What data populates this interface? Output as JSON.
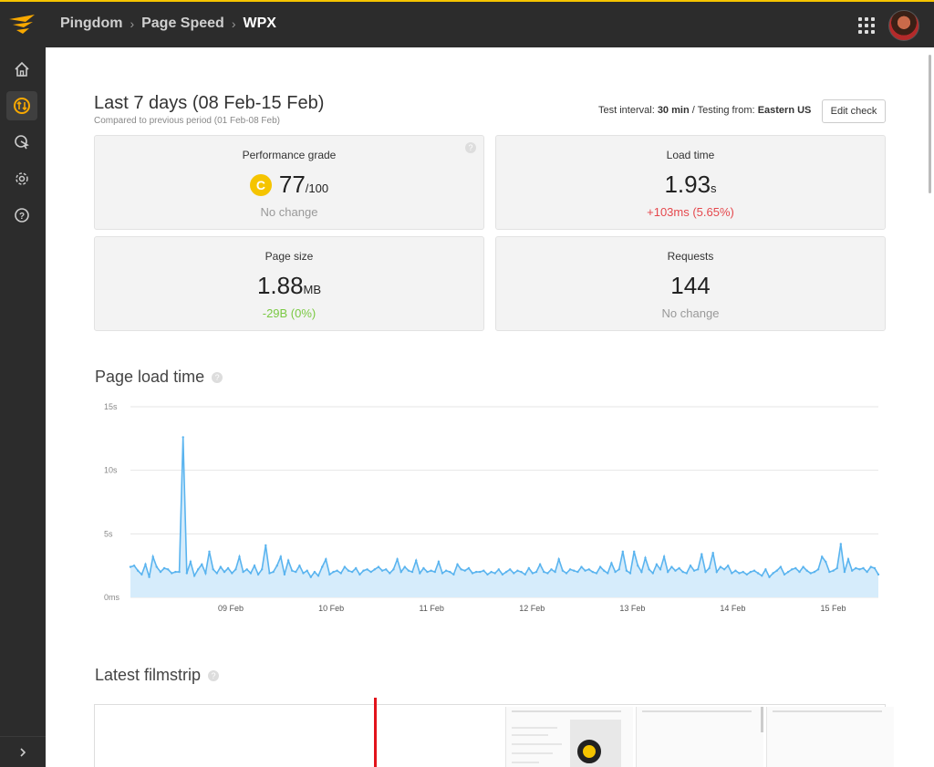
{
  "topbar": {
    "breadcrumb": [
      "Pingdom",
      "Page Speed",
      "WPX"
    ]
  },
  "summary": {
    "period_title": "Last 7 days (08 Feb-15 Feb)",
    "period_sub": "Compared to previous period (01 Feb-08 Feb)",
    "test_interval_label": "Test interval:",
    "test_interval_value": "30 min",
    "testing_from_label": "/ Testing from:",
    "testing_from_value": "Eastern US",
    "edit_button": "Edit check"
  },
  "cards": {
    "grade": {
      "label": "Performance grade",
      "letter": "C",
      "value": "77",
      "suffix": "/100",
      "change": "No change"
    },
    "load_time": {
      "label": "Load time",
      "value": "1.93",
      "unit": "s",
      "change": "+103ms (5.65%)"
    },
    "page_size": {
      "label": "Page size",
      "value": "1.88",
      "unit": "MB",
      "change": "-29B (0%)"
    },
    "requests": {
      "label": "Requests",
      "value": "144",
      "change": "No change"
    }
  },
  "sections": {
    "load_time_title": "Page load time",
    "filmstrip_title": "Latest filmstrip"
  },
  "colors": {
    "accent": "#f5c400",
    "line": "#5ab4ef",
    "fill": "#d6ecfb",
    "bad": "#e5484d",
    "good": "#7ac943"
  },
  "chart_data": {
    "type": "area",
    "title": "Page load time",
    "ylabel": "",
    "xlabel": "",
    "ylim": [
      0,
      15
    ],
    "y_ticks": [
      "0ms",
      "5s",
      "10s",
      "15s"
    ],
    "x_ticks": [
      "09 Feb",
      "10 Feb",
      "11 Feb",
      "12 Feb",
      "13 Feb",
      "14 Feb",
      "15 Feb"
    ],
    "x_range_days": [
      8.0,
      15.45
    ],
    "grid": true,
    "series": [
      {
        "values": [
          2.4,
          2.5,
          2.1,
          1.8,
          2.6,
          1.6,
          3.2,
          2.4,
          2.0,
          2.3,
          2.2,
          1.9,
          2.0,
          2.0,
          12.6,
          1.9,
          2.8,
          1.7,
          2.2,
          2.6,
          1.9,
          3.6,
          2.2,
          1.9,
          2.4,
          2.0,
          2.3,
          1.9,
          2.2,
          3.2,
          2.0,
          2.2,
          1.9,
          2.5,
          1.8,
          2.2,
          4.1,
          1.9,
          2.0,
          2.5,
          3.2,
          1.8,
          2.9,
          2.1,
          2.0,
          2.5,
          1.9,
          2.1,
          1.6,
          2.0,
          1.7,
          2.4,
          3.0,
          1.8,
          2.0,
          2.1,
          1.9,
          2.4,
          2.1,
          2.0,
          2.3,
          1.8,
          2.1,
          2.2,
          2.0,
          2.2,
          2.4,
          2.1,
          2.2,
          1.9,
          2.2,
          3.0,
          2.0,
          2.4,
          2.1,
          2.0,
          2.9,
          1.9,
          2.3,
          2.0,
          2.1,
          2.0,
          2.8,
          1.9,
          2.1,
          2.0,
          1.8,
          2.6,
          2.2,
          2.1,
          2.3,
          1.9,
          2.0,
          2.0,
          2.1,
          1.8,
          2.0,
          1.9,
          2.2,
          1.8,
          2.0,
          2.2,
          1.9,
          2.1,
          2.0,
          1.8,
          2.3,
          1.9,
          2.0,
          2.6,
          2.0,
          1.9,
          2.2,
          2.0,
          3.0,
          2.1,
          1.9,
          2.2,
          2.1,
          2.0,
          2.4,
          2.1,
          2.2,
          2.0,
          1.9,
          2.4,
          2.1,
          1.9,
          2.7,
          2.0,
          2.2,
          3.6,
          2.1,
          1.9,
          3.6,
          2.5,
          2.0,
          3.1,
          2.2,
          1.9,
          2.6,
          2.2,
          3.2,
          2.0,
          2.4,
          2.1,
          2.3,
          2.0,
          1.9,
          2.5,
          2.1,
          2.2,
          3.4,
          2.0,
          2.3,
          3.5,
          2.0,
          2.4,
          2.2,
          2.5,
          1.9,
          2.1,
          1.9,
          2.0,
          1.8,
          2.0,
          2.1,
          1.9,
          1.7,
          2.2,
          1.6,
          1.9,
          2.1,
          2.4,
          1.8,
          2.0,
          2.2,
          2.3,
          2.0,
          2.4,
          2.1,
          1.9,
          2.0,
          2.2,
          3.2,
          2.8,
          2.0,
          2.1,
          2.3,
          4.2,
          2.0,
          3.0,
          2.1,
          2.3,
          2.2,
          2.3,
          2.0,
          2.4,
          2.3,
          1.8
        ]
      }
    ]
  }
}
